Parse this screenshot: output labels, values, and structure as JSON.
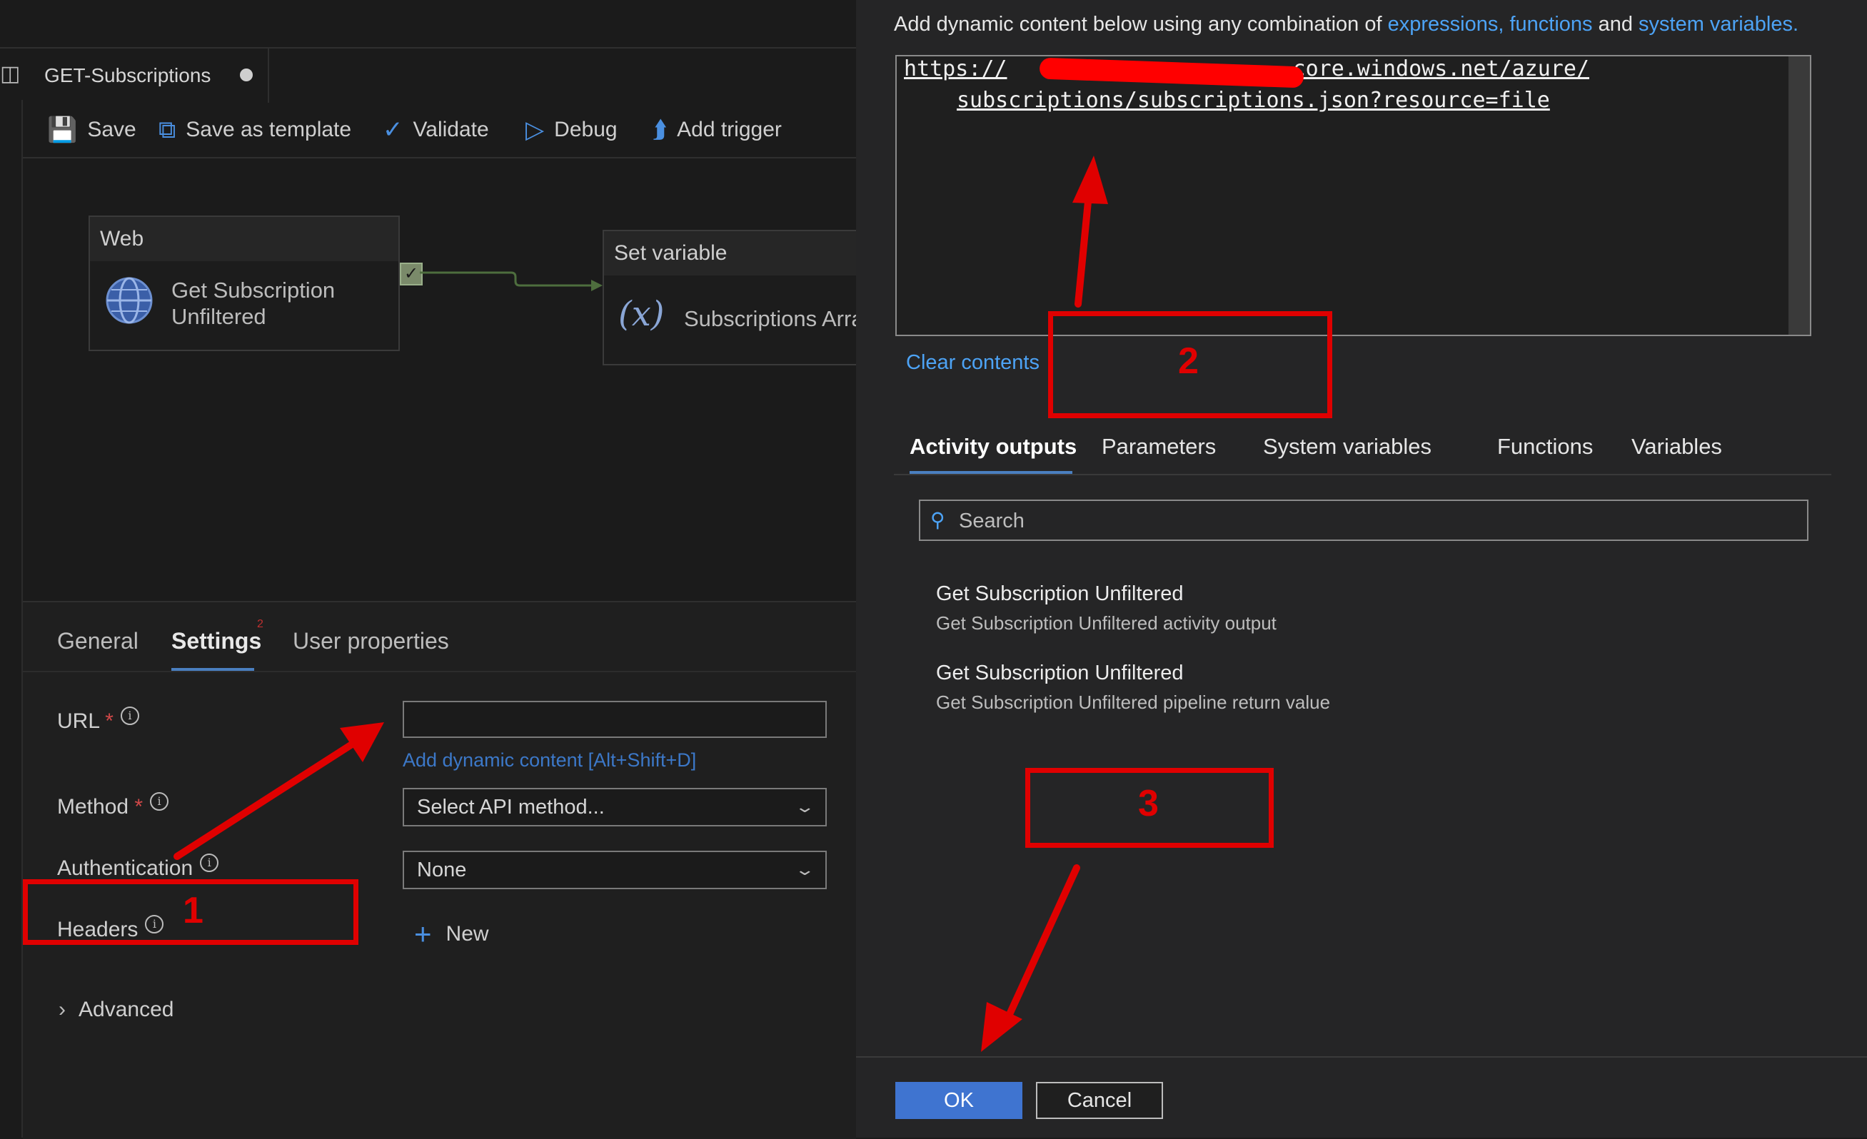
{
  "pipeline": {
    "name": "GET-Subscriptions"
  },
  "toolbar": {
    "save": "Save",
    "save_template": "Save as template",
    "validate": "Validate",
    "debug": "Debug",
    "add_trigger": "Add trigger"
  },
  "canvas": {
    "web_node": {
      "type": "Web",
      "name_line1": "Get Subscription",
      "name_line2": "Unfiltered"
    },
    "setvar_node": {
      "type": "Set variable",
      "name": "Subscriptions Arra"
    }
  },
  "settings": {
    "tabs": [
      "General",
      "Settings",
      "User properties"
    ],
    "settings_badge": "2",
    "url_label": "URL",
    "url_value": "",
    "dynamic_link": "Add dynamic content [Alt+Shift+D]",
    "method_label": "Method",
    "method_value": "Select API method...",
    "auth_label": "Authentication",
    "auth_value": "None",
    "headers_label": "Headers",
    "new_label": "New",
    "advanced_label": "Advanced",
    "required_mark": "*"
  },
  "dialog": {
    "intro_prefix": "Add dynamic content below using any combination of ",
    "intro_link1": "expressions, functions",
    "intro_and": " and ",
    "intro_link2": "system variables.",
    "url_line1_a": "https://",
    "url_line1_b": ".core.windows.net/azure/",
    "url_line2": "subscriptions/subscriptions.json?resource=file",
    "clear": "Clear contents",
    "tabs": [
      "Activity outputs",
      "Parameters",
      "System variables",
      "Functions",
      "Variables"
    ],
    "search_placeholder": "Search",
    "outputs": [
      {
        "title": "Get Subscription Unfiltered",
        "sub": "Get Subscription Unfiltered activity output"
      },
      {
        "title": "Get Subscription Unfiltered",
        "sub": "Get Subscription Unfiltered pipeline return value"
      }
    ],
    "ok": "OK",
    "cancel": "Cancel"
  },
  "annotations": {
    "n1": "1",
    "n2": "2",
    "n3": "3"
  },
  "colors": {
    "accent": "#4a7fc0",
    "link": "#4da3f5",
    "annotation": "#e00000",
    "ok": "#3f74d0"
  }
}
